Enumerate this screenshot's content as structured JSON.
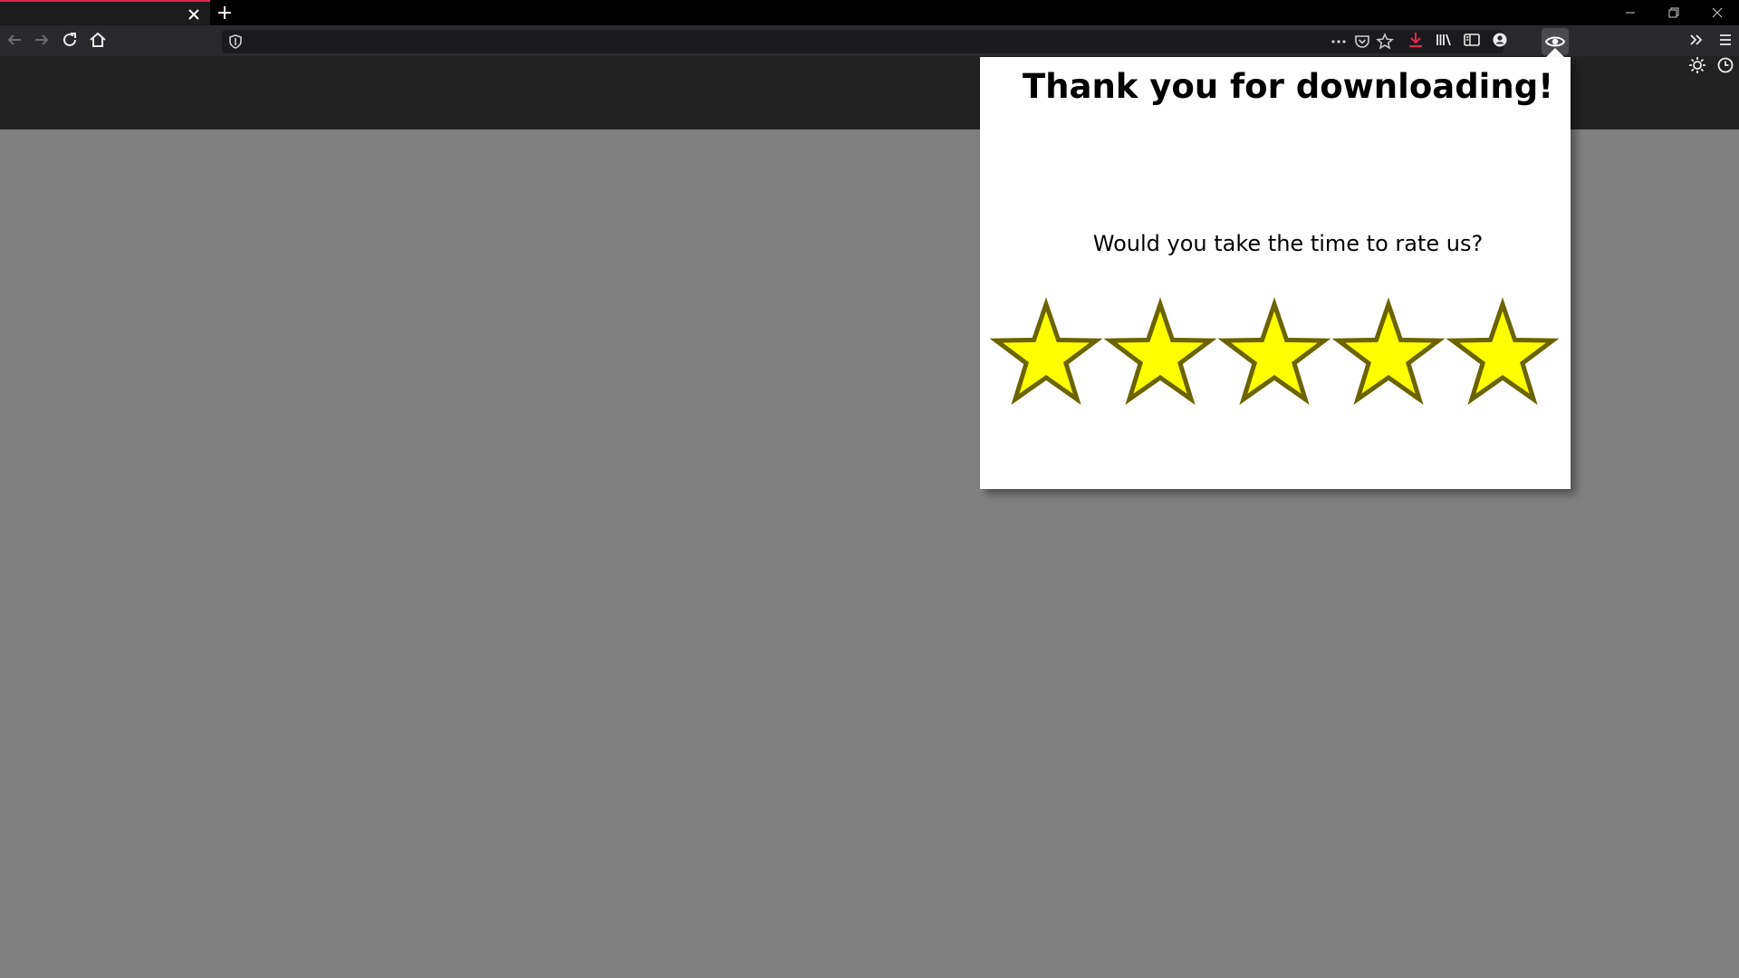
{
  "browser": {
    "accent_color": "#e22850",
    "tab": {
      "title": "",
      "close_icon": "close-icon"
    },
    "new_tab_icon": "plus-icon",
    "window_controls": [
      "minimize-icon",
      "restore-icon",
      "close-icon"
    ],
    "toolbar_icons": [
      "back-arrow-icon",
      "forward-arrow-icon",
      "reload-icon",
      "home-icon"
    ],
    "url": "",
    "url_icon": "shield-icon",
    "url_actions": [
      "more-dots-icon",
      "pocket-icon",
      "bookmark-star-icon"
    ],
    "right_icons": [
      "download-arrow-icon",
      "library-icon",
      "sidebar-icon",
      "account-icon",
      "eye-extension-icon",
      "chevrons-right-icon",
      "hamburger-menu-icon",
      "gear-icon",
      "clock-icon"
    ],
    "download_color": "#e22850"
  },
  "popup": {
    "title": "Thank you for downloading!",
    "question": "Would you take the time to rate us?",
    "rating": {
      "max": 5,
      "star_fill": "#ffff00",
      "star_stroke": "#6b6400"
    }
  }
}
